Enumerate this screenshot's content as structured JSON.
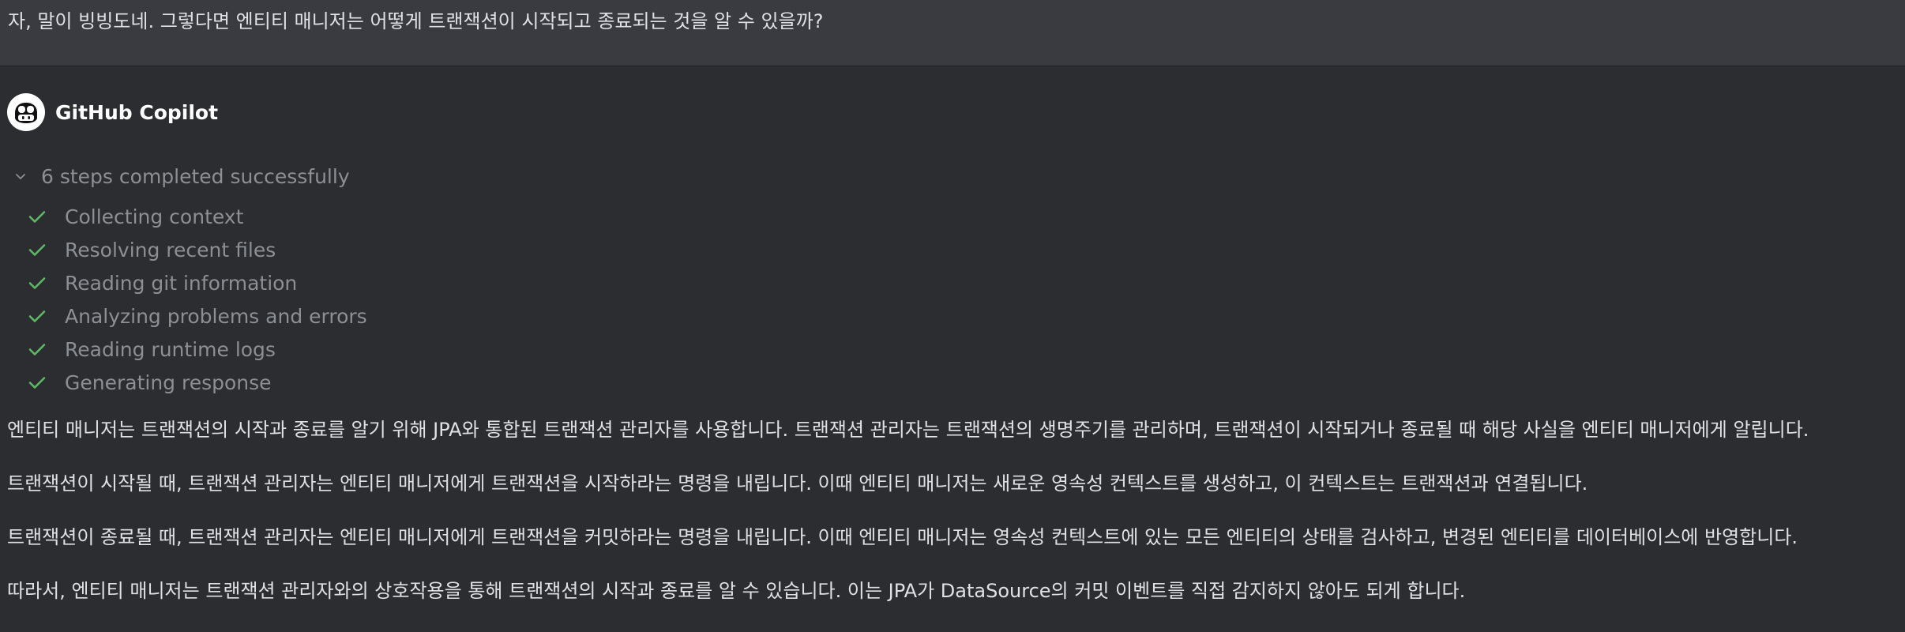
{
  "user_message": {
    "text": "자, 말이 빙빙도네. 그렇다면 엔티티 매니저는 어떻게 트랜잭션이 시작되고 종료되는 것을 알 수 있을까?"
  },
  "assistant": {
    "name": "GitHub Copilot",
    "avatar_icon": "copilot-icon"
  },
  "steps": {
    "summary": "6 steps completed successfully",
    "expanded": true,
    "toggle_icon": "chevron-down-icon",
    "check_color": "#5fb865",
    "items": [
      {
        "label": "Collecting context",
        "icon": "check-icon"
      },
      {
        "label": "Resolving recent files",
        "icon": "check-icon"
      },
      {
        "label": "Reading git information",
        "icon": "check-icon"
      },
      {
        "label": "Analyzing problems and errors",
        "icon": "check-icon"
      },
      {
        "label": "Reading runtime logs",
        "icon": "check-icon"
      },
      {
        "label": "Generating response",
        "icon": "check-icon"
      }
    ]
  },
  "answer": {
    "paragraphs": [
      "엔티티 매니저는 트랜잭션의 시작과 종료를 알기 위해 JPA와 통합된 트랜잭션 관리자를 사용합니다. 트랜잭션 관리자는 트랜잭션의 생명주기를 관리하며, 트랜잭션이 시작되거나 종료될 때 해당 사실을 엔티티 매니저에게 알립니다.",
      "트랜잭션이 시작될 때, 트랜잭션 관리자는 엔티티 매니저에게 트랜잭션을 시작하라는 명령을 내립니다. 이때 엔티티 매니저는 새로운 영속성 컨텍스트를 생성하고, 이 컨텍스트는 트랜잭션과 연결됩니다.",
      "트랜잭션이 종료될 때, 트랜잭션 관리자는 엔티티 매니저에게 트랜잭션을 커밋하라는 명령을 내립니다. 이때 엔티티 매니저는 영속성 컨텍스트에 있는 모든 엔티티의 상태를 검사하고, 변경된 엔티티를 데이터베이스에 반영합니다.",
      "따라서, 엔티티 매니저는 트랜잭션 관리자와의 상호작용을 통해 트랜잭션의 시작과 종료를 알 수 있습니다. 이는 JPA가 DataSource의 커밋 이벤트를 직접 감지하지 않아도 되게 합니다."
    ]
  }
}
